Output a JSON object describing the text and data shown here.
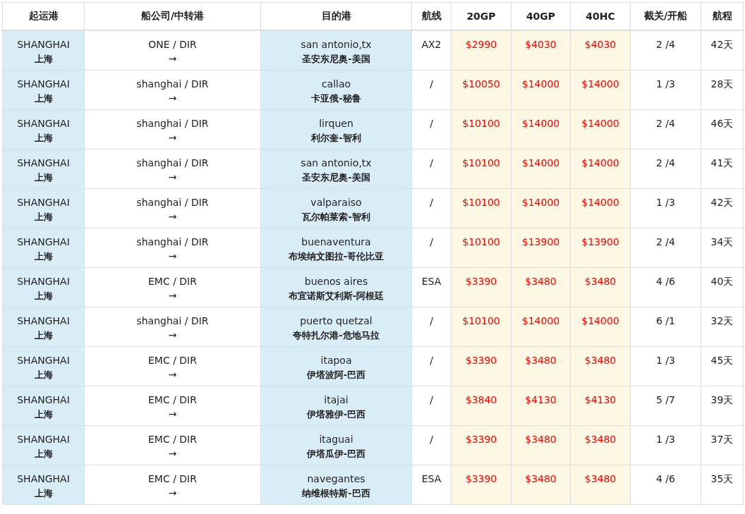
{
  "table": {
    "columns": [
      "起运港",
      "船公司/中转港",
      "目的港",
      "航线",
      "20GP",
      "40GP",
      "40HC",
      "截关/开船",
      "航程"
    ],
    "rows": [
      {
        "origin": "SHANGHAI",
        "origin_cn": "上海",
        "carrier": "ONE / DIR",
        "arrow": "→",
        "destination": "san antonio,tx",
        "destination_cn": "圣安东尼奥-美国",
        "route": "AX2",
        "gp20": "$2990",
        "gp40": "$4030",
        "hc40": "$4030",
        "cutoff_sailing": "2 /4",
        "transit": "42天"
      },
      {
        "origin": "SHANGHAI",
        "origin_cn": "上海",
        "carrier": "shanghai / DIR",
        "arrow": "→",
        "destination": "callao",
        "destination_cn": "卡亚俄-秘鲁",
        "route": "/",
        "gp20": "$10050",
        "gp40": "$14000",
        "hc40": "$14000",
        "cutoff_sailing": "1 /3",
        "transit": "28天"
      },
      {
        "origin": "SHANGHAI",
        "origin_cn": "上海",
        "carrier": "shanghai / DIR",
        "arrow": "→",
        "destination": "lirquen",
        "destination_cn": "利尔奎-智利",
        "route": "/",
        "gp20": "$10100",
        "gp40": "$14000",
        "hc40": "$14000",
        "cutoff_sailing": "2 /4",
        "transit": "46天"
      },
      {
        "origin": "SHANGHAI",
        "origin_cn": "上海",
        "carrier": "shanghai / DIR",
        "arrow": "→",
        "destination": "san antonio,tx",
        "destination_cn": "圣安东尼奥-美国",
        "route": "/",
        "gp20": "$10100",
        "gp40": "$14000",
        "hc40": "$14000",
        "cutoff_sailing": "2 /4",
        "transit": "41天"
      },
      {
        "origin": "SHANGHAI",
        "origin_cn": "上海",
        "carrier": "shanghai / DIR",
        "arrow": "→",
        "destination": "valparaiso",
        "destination_cn": "瓦尔帕莱索-智利",
        "route": "/",
        "gp20": "$10100",
        "gp40": "$14000",
        "hc40": "$14000",
        "cutoff_sailing": "1 /3",
        "transit": "42天"
      },
      {
        "origin": "SHANGHAI",
        "origin_cn": "上海",
        "carrier": "shanghai / DIR",
        "arrow": "→",
        "destination": "buenaventura",
        "destination_cn": "布埃纳文图拉-哥伦比亚",
        "route": "/",
        "gp20": "$10100",
        "gp40": "$13900",
        "hc40": "$13900",
        "cutoff_sailing": "2 /4",
        "transit": "34天"
      },
      {
        "origin": "SHANGHAI",
        "origin_cn": "上海",
        "carrier": "EMC / DIR",
        "arrow": "→",
        "destination": "buenos aires",
        "destination_cn": "布宜诺斯艾利斯-阿根廷",
        "route": "ESA",
        "gp20": "$3390",
        "gp40": "$3480",
        "hc40": "$3480",
        "cutoff_sailing": "4 /6",
        "transit": "40天"
      },
      {
        "origin": "SHANGHAI",
        "origin_cn": "上海",
        "carrier": "shanghai / DIR",
        "arrow": "→",
        "destination": "puerto quetzal",
        "destination_cn": "夸特扎尔港-危地马拉",
        "route": "/",
        "gp20": "$10100",
        "gp40": "$14000",
        "hc40": "$14000",
        "cutoff_sailing": "6 /1",
        "transit": "32天"
      },
      {
        "origin": "SHANGHAI",
        "origin_cn": "上海",
        "carrier": "EMC / DIR",
        "arrow": "→",
        "destination": "itapoa",
        "destination_cn": "伊塔波阿-巴西",
        "route": "/",
        "gp20": "$3390",
        "gp40": "$3480",
        "hc40": "$3480",
        "cutoff_sailing": "1 /3",
        "transit": "45天"
      },
      {
        "origin": "SHANGHAI",
        "origin_cn": "上海",
        "carrier": "EMC / DIR",
        "arrow": "→",
        "destination": "itajai",
        "destination_cn": "伊塔雅伊-巴西",
        "route": "/",
        "gp20": "$3840",
        "gp40": "$4130",
        "hc40": "$4130",
        "cutoff_sailing": "5 /7",
        "transit": "39天"
      },
      {
        "origin": "SHANGHAI",
        "origin_cn": "上海",
        "carrier": "EMC / DIR",
        "arrow": "→",
        "destination": "itaguai",
        "destination_cn": "伊塔瓜伊-巴西",
        "route": "/",
        "gp20": "$3390",
        "gp40": "$3480",
        "hc40": "$3480",
        "cutoff_sailing": "1 /3",
        "transit": "37天"
      },
      {
        "origin": "SHANGHAI",
        "origin_cn": "上海",
        "carrier": "EMC / DIR",
        "arrow": "→",
        "destination": "navegantes",
        "destination_cn": "纳维根特斯-巴西",
        "route": "ESA",
        "gp20": "$3390",
        "gp40": "$3480",
        "hc40": "$3480",
        "cutoff_sailing": "4 /6",
        "transit": "35天"
      }
    ]
  }
}
